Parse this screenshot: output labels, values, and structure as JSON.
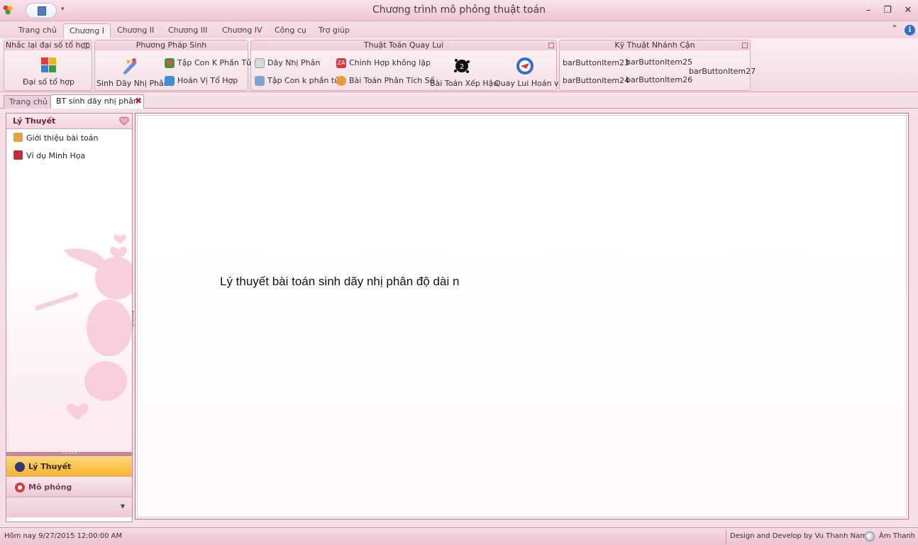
{
  "window": {
    "title": "Chương trình mô phỏng thuật toán",
    "minimize_icon": "minimize-icon",
    "restore_icon": "restore-icon",
    "close_icon": "close-icon"
  },
  "ribbon": {
    "tabs": [
      {
        "label": "Trang chủ"
      },
      {
        "label": "Chương I"
      },
      {
        "label": "Chương II"
      },
      {
        "label": "Chương III"
      },
      {
        "label": "Chương IV"
      },
      {
        "label": "Công cụ"
      },
      {
        "label": "Trợ giúp"
      }
    ],
    "active_tab": "Chương I",
    "groups": {
      "nhac_lai": {
        "title": "Nhắc lại đại số tổ hợp",
        "large_button": "Đại số tổ hợp"
      },
      "phuong_phap_sinh": {
        "title": "Phương Pháp Sinh",
        "large_button": "Sinh Dãy Nhị Phân",
        "small_buttons": [
          "Tập Con K Phần Tử",
          "Hoán Vị Tổ Hợp"
        ]
      },
      "quay_lui": {
        "title": "Thuật Toán Quay Lui",
        "small_buttons": [
          "Dãy Nhị Phân",
          "Tập Con k phần tử",
          "Chỉnh Hợp không lặp",
          "Bài Toán Phân Tích Số"
        ],
        "large_buttons": [
          "Bài Toán Xếp Hậu",
          "Quay Lui Hoán vị"
        ]
      },
      "nhanh_can": {
        "title": "Kỹ Thuật Nhánh Cận",
        "buttons": [
          "barButtonItem23",
          "barButtonItem25",
          "barButtonItem24",
          "barButtonItem26",
          "barButtonItem27"
        ]
      }
    }
  },
  "document_tabs": [
    {
      "label": "Trang chủ"
    },
    {
      "label": "BT sinh dãy nhị phân"
    }
  ],
  "active_document": "BT sinh dãy nhị phân",
  "nav_pane": {
    "header": "Lý Thuyết",
    "items": [
      {
        "label": "Giới thiệu bài toán",
        "icon": "people-icon"
      },
      {
        "label": "Ví dụ Minh Họa",
        "icon": "book-icon"
      }
    ],
    "groups": [
      {
        "label": "Lý Thuyết",
        "active": true,
        "icon": "theory-icon"
      },
      {
        "label": "Mô phỏng",
        "active": false,
        "icon": "simulation-icon"
      }
    ]
  },
  "content": {
    "text": "Lý thuyết bài toán sinh dãy nhị phân độ dài n"
  },
  "status_bar": {
    "date": "Hôm nay 9/27/2015 12:00:00 AM",
    "credit": "Design and Develop by Vu Thanh Nam",
    "sound": "Âm Thanh"
  },
  "colors": {
    "accent_pink": "#f3d4df",
    "active_group": "#f6b530",
    "border": "#b07286"
  }
}
